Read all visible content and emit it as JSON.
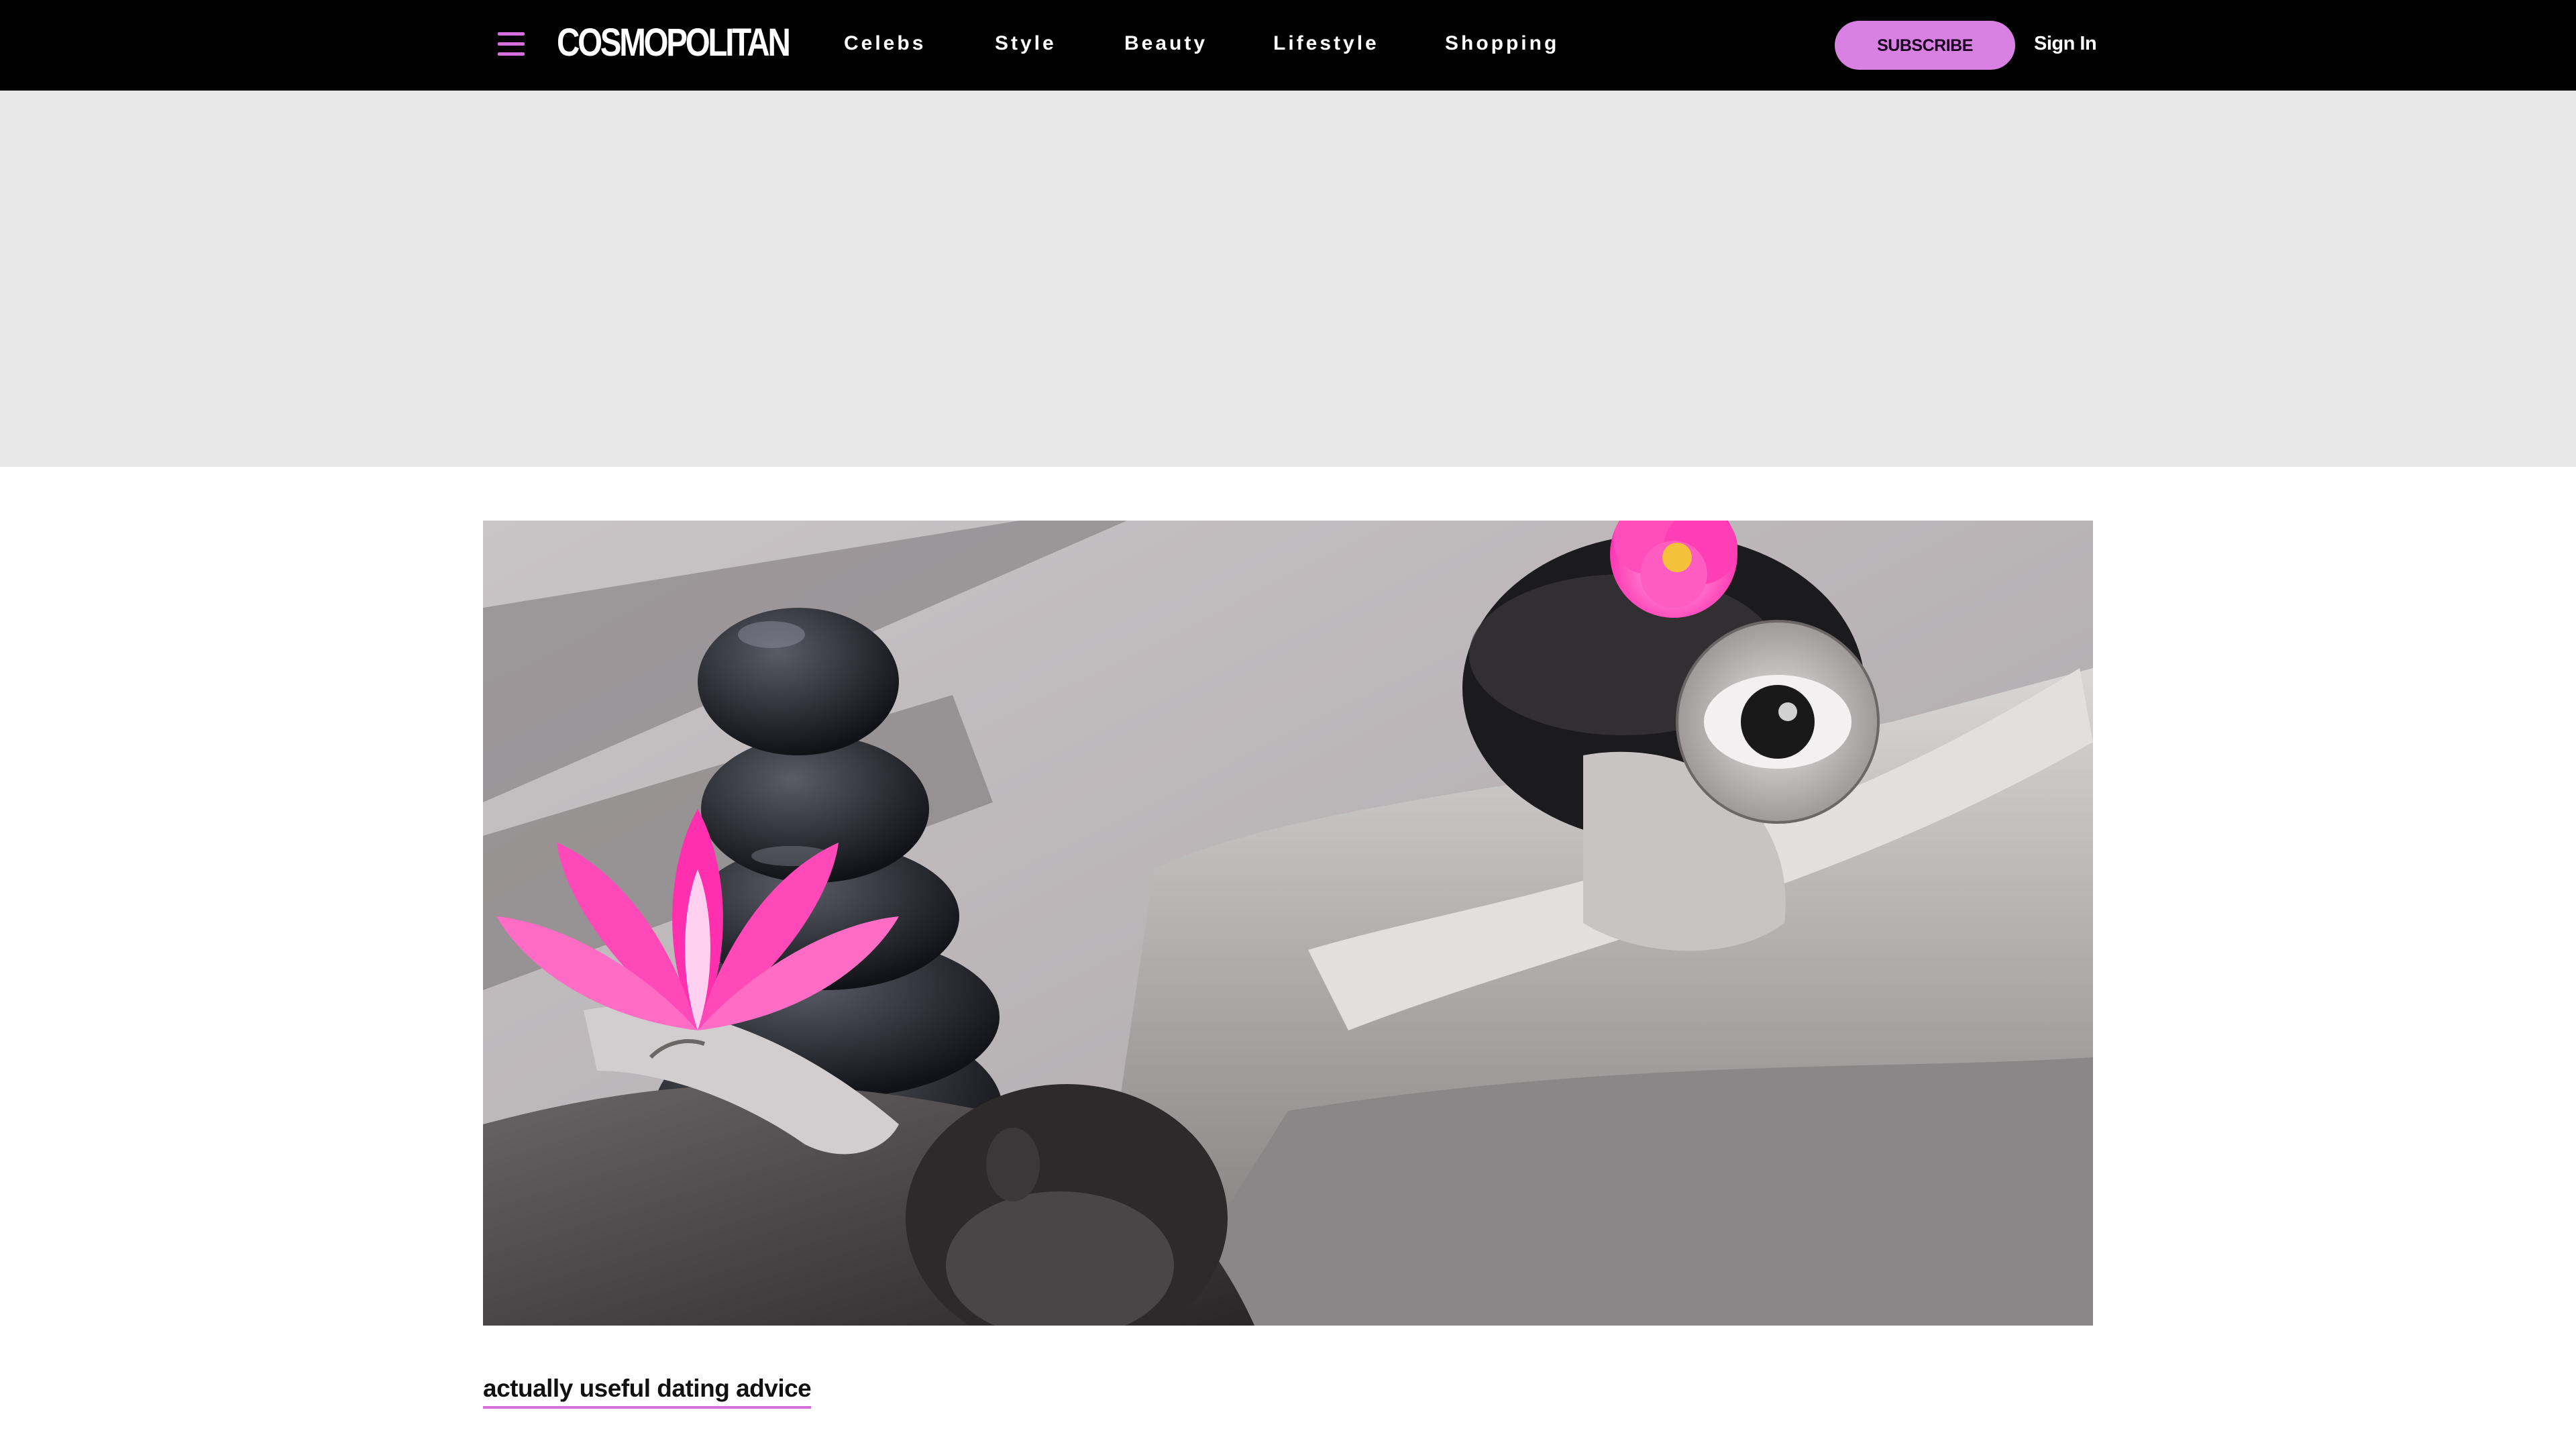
{
  "header": {
    "menu_icon": "hamburger-menu-icon",
    "logo_text": "COSMOPOLITAN",
    "nav": [
      "Celebs",
      "Style",
      "Beauty",
      "Lifestyle",
      "Shopping"
    ],
    "subscribe_label": "SUBSCRIBE",
    "signin_label": "Sign In"
  },
  "colors": {
    "header_bg": "#000000",
    "accent": "#d980e3",
    "ad_bg": "#e8e8e8"
  },
  "article": {
    "category_link": "actually useful dating advice"
  }
}
